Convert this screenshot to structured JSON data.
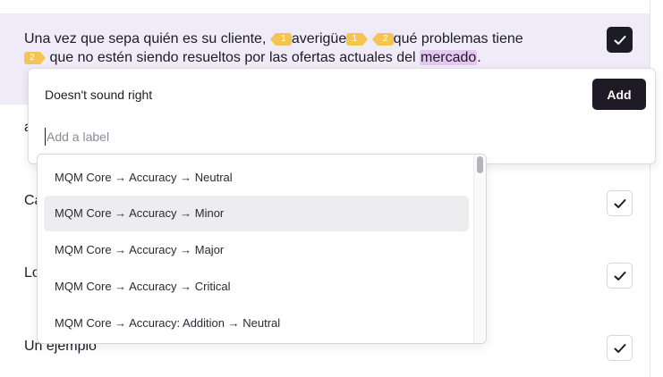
{
  "segment": {
    "text_a": "Una vez que sepa quién es su cliente, ",
    "tag1_open": "1",
    "text_b": "averigüe",
    "tag1_close": "1",
    "tag2_open": "2",
    "text_c": "qué problemas tiene",
    "tag2_close": "2",
    "text_d": " que no estén siendo resueltos por las ofertas actuales del ",
    "highlighted_word": "mercado",
    "text_e": "."
  },
  "rows": [
    {
      "snippet": "a"
    },
    {
      "snippet": "Ca"
    },
    {
      "snippet": "Lo"
    },
    {
      "snippet": "Un ejemplo"
    }
  ],
  "issue_panel": {
    "title": "Doesn't sound right",
    "add_label": "Add",
    "input_placeholder": "Add a label",
    "input_value": ""
  },
  "dropdown": {
    "options": [
      "MQM Core → Accuracy → Neutral",
      "MQM Core → Accuracy → Minor",
      "MQM Core → Accuracy → Major",
      "MQM Core → Accuracy → Critical",
      "MQM Core → Accuracy: Addition → Neutral"
    ],
    "highlighted_index": 1
  },
  "icons": {
    "check": "checkmark-icon"
  },
  "colors": {
    "row_highlight": "#f0ebf8",
    "tag": "#f5c451",
    "highlighted_word": "#e6c7f2",
    "primary_button": "#1e1b26"
  }
}
